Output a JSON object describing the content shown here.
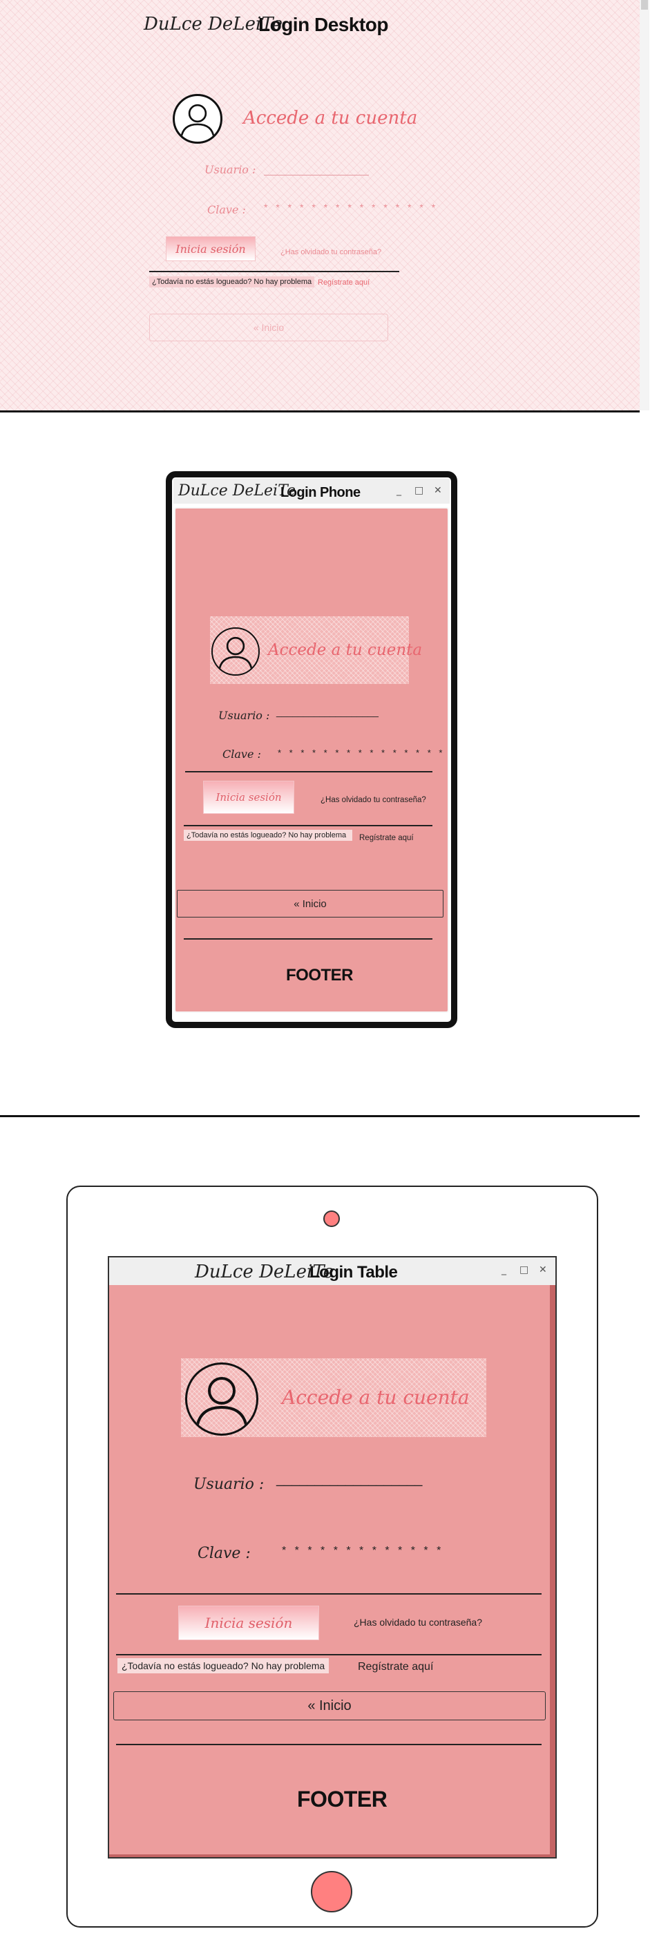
{
  "brand": "DuLce DeLeiTe",
  "desktop": {
    "title": "Login Desktop",
    "heading": "Accede a tu cuenta",
    "username_label": "Usuario :",
    "password_label": "Clave :",
    "password_mask": "* * * * * * * * * * * * * * *",
    "login_button": "Inicia sesión",
    "forgot_link": "¿Has olvidado tu contraseña?",
    "not_logged_text": "¿Todavía no estás logueado? No hay problema",
    "register_link": "Regístrate aquí",
    "home_button": "« Inicio"
  },
  "phone": {
    "title": "Login Phone",
    "window_controls": {
      "minimize": "_",
      "maximize": "□",
      "close": "✕"
    },
    "heading": "Accede a tu cuenta",
    "username_label": "Usuario :",
    "username_line": "___________________",
    "password_label": "Clave :",
    "password_mask": "* * * * * * * * * * * * * * *",
    "login_button": "Inicia sesión",
    "forgot_link": "¿Has olvidado tu contraseña?",
    "not_logged_text": "¿Todavía no estás logueado? No hay problema",
    "register_link": "Regístrate aquí",
    "home_button": "« Inicio",
    "footer": "FOOTER"
  },
  "tablet": {
    "title": "Login Table",
    "window_controls": {
      "minimize": "_",
      "maximize": "□",
      "close": "✕"
    },
    "heading": "Accede a tu cuenta",
    "username_label": "Usuario :",
    "username_line": "___________________",
    "password_label": "Clave :",
    "password_mask": "* * * * * * * * * * * * *",
    "login_button": "Inicia sesión",
    "forgot_link": "¿Has olvidado tu contraseña?",
    "not_logged_text": "¿Todavía no estás logueado? No hay problema",
    "register_link": "Regístrate aquí",
    "home_button": "« Inicio",
    "footer": "FOOTER"
  },
  "colors": {
    "pink_bg": "#fcebec",
    "screen_pink": "#ec9d9d",
    "accent_text": "#e8666f",
    "camera_dot": "#ff8080"
  }
}
